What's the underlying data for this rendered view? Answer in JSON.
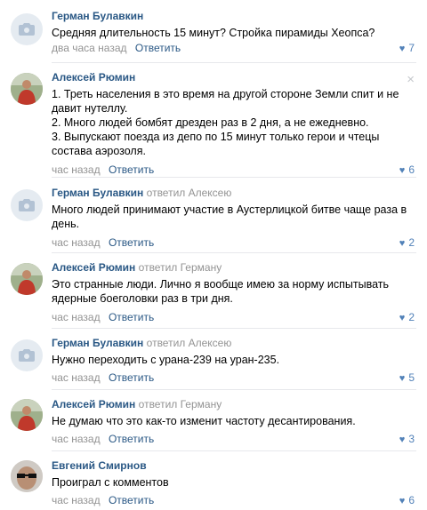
{
  "comments": [
    {
      "author": "Герман Булавкин",
      "reply_to": "",
      "lines": [
        "Средняя длительность 15 минут? Стройка пирамиды Хеопса?"
      ],
      "time": "два часа назад",
      "reply_label": "Ответить",
      "likes": "7",
      "avatar": "camera-placeholder"
    },
    {
      "author": "Алексей Рюмин",
      "reply_to": "",
      "lines": [
        "1. Треть населения в это время на другой стороне Земли спит и не давит нутеллу.",
        "2. Много людей бомбят дрезден раз в 2 дня, а не ежедневно.",
        "3. Выпускают поезда из депо по 15 минут только герои и чтецы состава аэрозоля."
      ],
      "time": "час назад",
      "reply_label": "Ответить",
      "likes": "6",
      "avatar": "photo",
      "close_glyph": "×"
    },
    {
      "author": "Герман Булавкин",
      "reply_to": "ответил Алексею",
      "lines": [
        "Много людей принимают участие в Аустерлицкой битве чаще раза в день."
      ],
      "time": "час назад",
      "reply_label": "Ответить",
      "likes": "2",
      "avatar": "camera-placeholder"
    },
    {
      "author": "Алексей Рюмин",
      "reply_to": "ответил Герману",
      "lines": [
        "Это странные люди. Лично я вообще имею за норму испытывать ядерные боеголовки раз в три дня."
      ],
      "time": "час назад",
      "reply_label": "Ответить",
      "likes": "2",
      "avatar": "photo"
    },
    {
      "author": "Герман Булавкин",
      "reply_to": "ответил Алексею",
      "lines": [
        "Нужно переходить с урана-239 на уран-235."
      ],
      "time": "час назад",
      "reply_label": "Ответить",
      "likes": "5",
      "avatar": "camera-placeholder"
    },
    {
      "author": "Алексей Рюмин",
      "reply_to": "ответил Герману",
      "lines": [
        "Не думаю что это как-то изменит частоту десантирования."
      ],
      "time": "час назад",
      "reply_label": "Ответить",
      "likes": "3",
      "avatar": "photo"
    },
    {
      "author": "Евгений Смирнов",
      "reply_to": "",
      "lines": [
        "Проиграл с комментов"
      ],
      "time": "час назад",
      "reply_label": "Ответить",
      "likes": "6",
      "avatar": "sunglasses"
    }
  ],
  "colors": {
    "author": "#2a5885",
    "link": "#2a5885",
    "muted": "#939393",
    "like": "#5181b8",
    "divider": "#e7e8ec"
  }
}
